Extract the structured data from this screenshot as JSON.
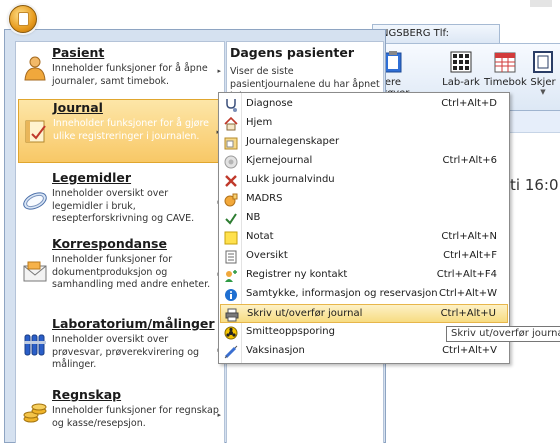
{
  "background_app": {
    "doc_tab": "NGSBERG Tlf:",
    "ribbon_buttons": [
      {
        "label": "ere prøver",
        "icon": "clipboard-icon"
      },
      {
        "label": "Lab-ark",
        "icon": "lab-sheet-icon"
      },
      {
        "label": "Timebok",
        "icon": "calendar-icon"
      },
      {
        "label": "Skjer",
        "icon": "form-icon"
      }
    ],
    "date_text": "ti 16:0"
  },
  "app_menu": {
    "items": [
      {
        "title": "Pasient",
        "desc": "Inneholder funksjoner for å åpne journaler, samt timebok.",
        "icon": "patient-icon"
      },
      {
        "title": "Journal",
        "desc": "Inneholder funksjoner for å gjøre ulike registreringer i journalen.",
        "icon": "journal-icon"
      },
      {
        "title": "Legemidler",
        "desc": "Inneholder oversikt over legemidler i bruk, resepterforskrivning og CAVE.",
        "icon": "capsule-icon"
      },
      {
        "title": "Korrespondanse",
        "desc": "Inneholder funksjoner for dokumentproduksjon og samhandling med andre enheter.",
        "icon": "envelope-icon"
      },
      {
        "title": "Laboratorium/målinger",
        "desc": "Inneholder oversikt over prøvesvar, prøverekvirering og målinger.",
        "icon": "test-tubes-icon"
      },
      {
        "title": "Regnskap",
        "desc": "Inneholder funksjoner for regnskap og kasse/resepsjon.",
        "icon": "coins-icon"
      }
    ],
    "right_pane": {
      "title": "Dagens pasienter",
      "desc": "Viser de siste pasientjournalene du har åpnet i dag"
    }
  },
  "journal_submenu": {
    "items": [
      {
        "label": "Diagnose",
        "shortcut": "Ctrl+Alt+D",
        "icon": "stethoscope-icon"
      },
      {
        "label": "Hjem",
        "shortcut": "",
        "icon": "home-icon"
      },
      {
        "label": "Journalegenskaper",
        "shortcut": "",
        "icon": "journal-properties-icon"
      },
      {
        "label": "Kjernejournal",
        "shortcut": "Ctrl+Alt+6",
        "icon": "core-journal-icon"
      },
      {
        "label": "Lukk journalvindu",
        "shortcut": "",
        "icon": "close-icon"
      },
      {
        "label": "MADRS",
        "shortcut": "",
        "icon": "madrs-icon"
      },
      {
        "label": "NB",
        "shortcut": "",
        "icon": "checkmark-icon"
      },
      {
        "label": "Notat",
        "shortcut": "Ctrl+Alt+N",
        "icon": "note-icon"
      },
      {
        "label": "Oversikt",
        "shortcut": "Ctrl+Alt+F",
        "icon": "overview-icon"
      },
      {
        "label": "Registrer ny kontakt",
        "shortcut": "Ctrl+Alt+F4",
        "icon": "new-contact-icon"
      },
      {
        "label": "Samtykke, informasjon og reservasjon",
        "shortcut": "Ctrl+Alt+W",
        "icon": "info-icon"
      },
      {
        "label": "Skriv ut/overfør journal",
        "shortcut": "Ctrl+Alt+U",
        "icon": "printer-icon"
      },
      {
        "label": "Smitteoppsporing",
        "shortcut": "",
        "icon": "biohazard-icon"
      },
      {
        "label": "Vaksinasjon",
        "shortcut": "Ctrl+Alt+V",
        "icon": "syringe-icon"
      }
    ],
    "tooltip": "Skriv ut/overfør journal"
  }
}
